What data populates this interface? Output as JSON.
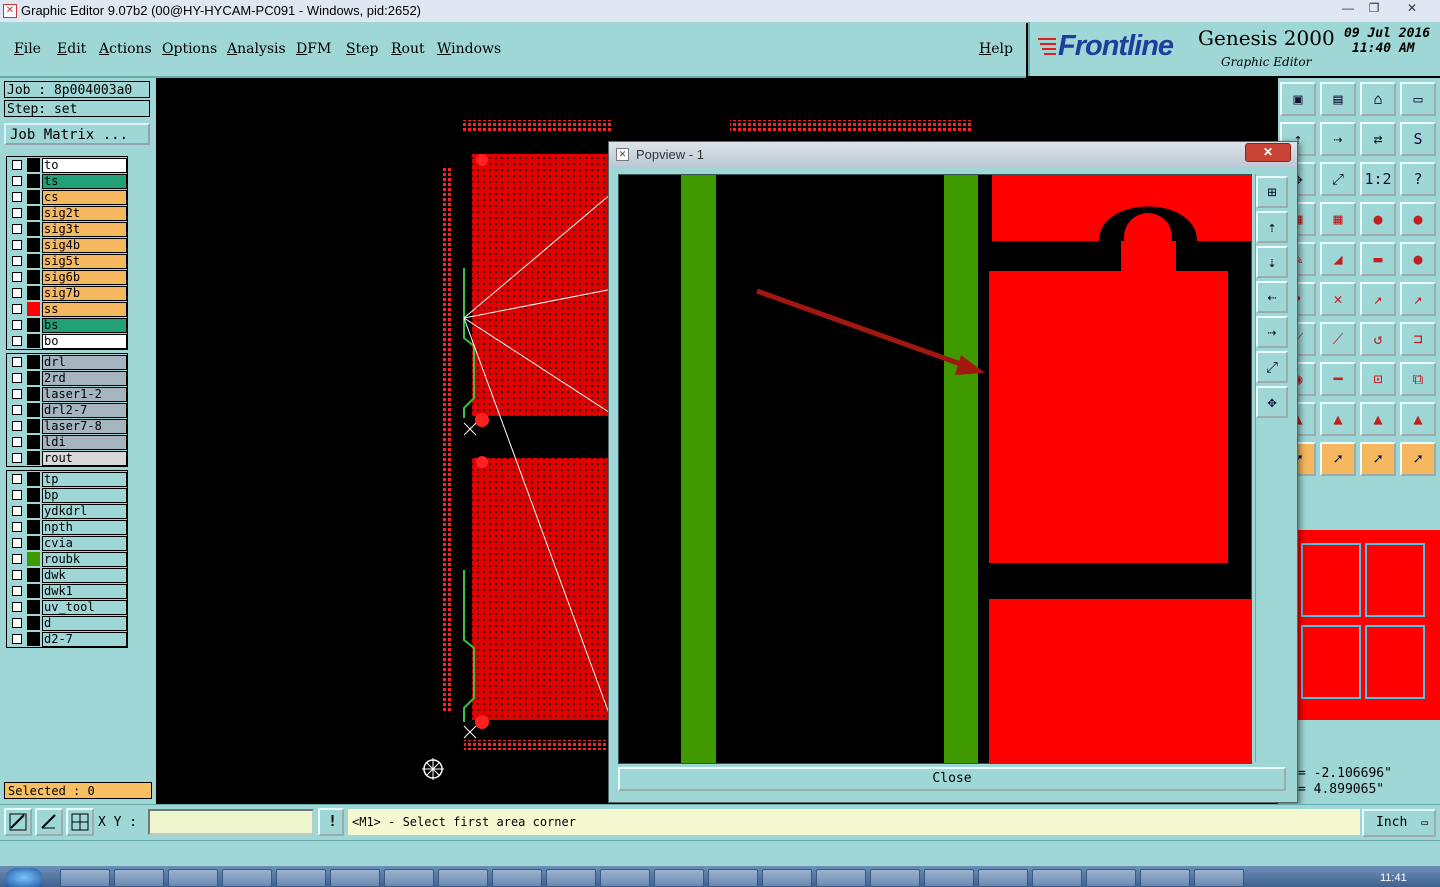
{
  "window": {
    "title": "Graphic Editor 9.07b2 (00@HY-HYCAM-PC091 - Windows, pid:2652)"
  },
  "menus": [
    "File",
    "Edit",
    "Actions",
    "Options",
    "Analysis",
    "DFM",
    "Step",
    "Rout",
    "Windows"
  ],
  "help": "Help",
  "brand": {
    "logo": "Frontline",
    "product": "Genesis 2000",
    "subtitle": "Graphic Editor",
    "date": "09 Jul 2016",
    "time": "11:40 AM"
  },
  "job": {
    "job_label": "Job : 8p004003a0",
    "step_label": "Step: set",
    "matrix_button": "Job Matrix ..."
  },
  "layers": {
    "group1": [
      {
        "name": "to",
        "color": "#ffffff",
        "swatch": "#000000"
      },
      {
        "name": "ts",
        "color": "#22a078",
        "swatch": "#000000"
      },
      {
        "name": "cs",
        "color": "#f5b860",
        "swatch": "#000000"
      },
      {
        "name": "sig2t",
        "color": "#f5b860",
        "swatch": "#000000"
      },
      {
        "name": "sig3t",
        "color": "#f5b860",
        "swatch": "#000000"
      },
      {
        "name": "sig4b",
        "color": "#f5b860",
        "swatch": "#000000"
      },
      {
        "name": "sig5t",
        "color": "#f5b860",
        "swatch": "#000000"
      },
      {
        "name": "sig6b",
        "color": "#f5b860",
        "swatch": "#000000"
      },
      {
        "name": "sig7b",
        "color": "#f5b860",
        "swatch": "#000000"
      },
      {
        "name": "ss",
        "color": "#f5b860",
        "swatch": "#ff0000"
      },
      {
        "name": "bs",
        "color": "#22a078",
        "swatch": "#000000"
      },
      {
        "name": "bo",
        "color": "#ffffff",
        "swatch": "#000000"
      }
    ],
    "group2": [
      {
        "name": "drl",
        "color": "#a6b4c0",
        "swatch": "#000000"
      },
      {
        "name": "2rd",
        "color": "#a6b4c0",
        "swatch": "#000000"
      },
      {
        "name": "laser1-2",
        "color": "#a6b4c0",
        "swatch": "#000000"
      },
      {
        "name": "drl2-7",
        "color": "#a6b4c0",
        "swatch": "#000000"
      },
      {
        "name": "laser7-8",
        "color": "#a6b4c0",
        "swatch": "#000000"
      },
      {
        "name": "ldi",
        "color": "#a6b4c0",
        "swatch": "#000000"
      },
      {
        "name": "rout",
        "color": "#d8d8d8",
        "swatch": "#000000"
      }
    ],
    "group3": [
      {
        "name": "tp",
        "color": "#9fd6d6",
        "swatch": "#000000"
      },
      {
        "name": "bp",
        "color": "#9fd6d6",
        "swatch": "#000000"
      },
      {
        "name": "ydkdrl",
        "color": "#9fd6d6",
        "swatch": "#000000"
      },
      {
        "name": "npth",
        "color": "#9fd6d6",
        "swatch": "#000000"
      },
      {
        "name": "cvia",
        "color": "#9fd6d6",
        "swatch": "#000000"
      },
      {
        "name": "roubk",
        "color": "#9fd6d6",
        "swatch": "#3f9a00"
      },
      {
        "name": "dwk",
        "color": "#9fd6d6",
        "swatch": "#000000"
      },
      {
        "name": "dwk1",
        "color": "#9fd6d6",
        "swatch": "#000000"
      },
      {
        "name": "uv_tool",
        "color": "#9fd6d6",
        "swatch": "#000000"
      },
      {
        "name": "d",
        "color": "#9fd6d6",
        "swatch": "#000000"
      },
      {
        "name": "d2-7",
        "color": "#9fd6d6",
        "swatch": "#000000"
      }
    ]
  },
  "selected": "Selected : 0",
  "popview": {
    "title": "Popview - 1",
    "close_x": "✕",
    "close_button": "Close"
  },
  "coords": {
    "x": "= -2.106696\"",
    "y": "= 4.899065\""
  },
  "bottom": {
    "xy_label": "X Y :",
    "xy_value": "",
    "warn": "!",
    "prompt": "<M1> - Select first area corner",
    "unit": "Inch"
  },
  "taskbar": {
    "clock": "11:41"
  },
  "colors": {
    "panel": "#9fd6d6",
    "copper": "#ff0000",
    "outline": "#3f9a00"
  }
}
